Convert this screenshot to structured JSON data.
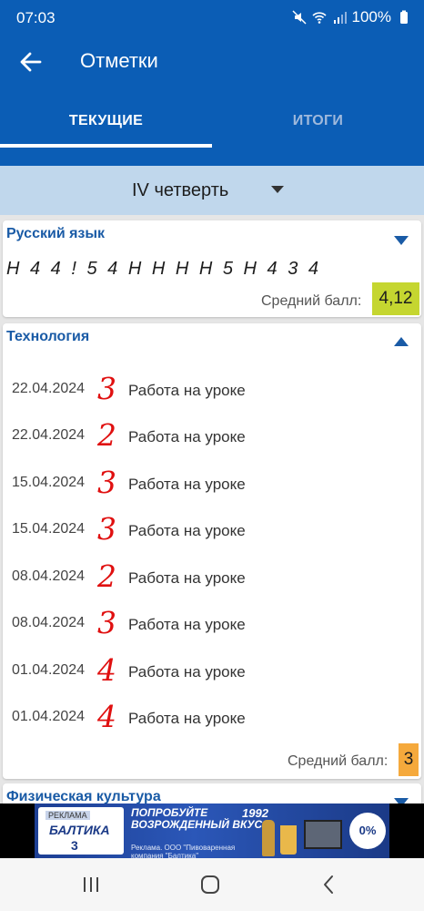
{
  "status_bar": {
    "time": "07:03",
    "battery": "100%",
    "icons": [
      "mute-icon",
      "wifi-icon",
      "signal-icon",
      "battery-icon"
    ]
  },
  "app_bar": {
    "title": "Отметки",
    "back_icon": "arrow-left-icon"
  },
  "tabs": [
    {
      "label": "ТЕКУЩИЕ",
      "selected": true
    },
    {
      "label": "ИТОГИ",
      "selected": false
    }
  ],
  "period": {
    "label": "IV четверть"
  },
  "subjects": [
    {
      "name": "Русский язык",
      "expanded": false,
      "marks_line": "Н 4 4 ! 5 4 Н Н Н Н 5 Н 4 3 4",
      "avg_label": "Средний балл:",
      "avg_value": "4,12",
      "avg_color": "#c5d630"
    },
    {
      "name": "Технология",
      "expanded": true,
      "entries": [
        {
          "date": "22.04.2024",
          "grade": "3",
          "desc": "Работа на уроке"
        },
        {
          "date": "22.04.2024",
          "grade": "2",
          "desc": "Работа на уроке"
        },
        {
          "date": "15.04.2024",
          "grade": "3",
          "desc": "Работа на уроке"
        },
        {
          "date": "15.04.2024",
          "grade": "3",
          "desc": "Работа на уроке"
        },
        {
          "date": "08.04.2024",
          "grade": "2",
          "desc": "Работа на уроке"
        },
        {
          "date": "08.04.2024",
          "grade": "3",
          "desc": "Работа на уроке"
        },
        {
          "date": "01.04.2024",
          "grade": "4",
          "desc": "Работа на уроке"
        },
        {
          "date": "01.04.2024",
          "grade": "4",
          "desc": "Работа на уроке"
        }
      ],
      "avg_label": "Средний балл:",
      "avg_value": "3",
      "avg_color": "#f5a93c"
    },
    {
      "name": "Физическая культура",
      "expanded": false
    }
  ],
  "ad": {
    "tag": "РЕКЛАМА",
    "brand": "БАЛТИКА",
    "brand_number": "3",
    "headline": "ПОПРОБУЙТЕ ВОЗРОЖДЕННЫЙ ВКУС",
    "disclaimer": "Реклама. ООО \"Пивоваренная компания \"Балтика\"",
    "year": "1992",
    "badge": "0%"
  },
  "colors": {
    "primary": "#0b5db5",
    "period_bg": "#c0d7ec",
    "grade_red": "#e01010",
    "subject_blue": "#1a5ba6"
  }
}
